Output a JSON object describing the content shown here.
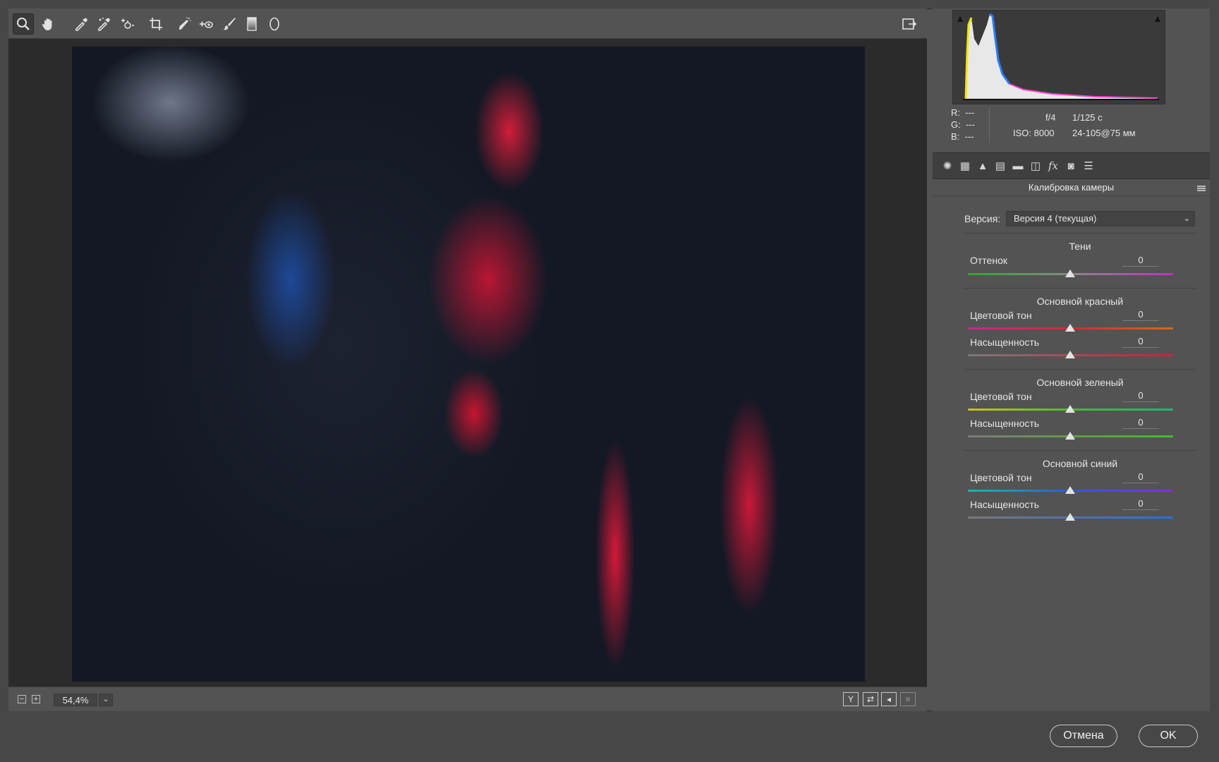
{
  "toolbar": {
    "tools": [
      "zoom-icon",
      "hand-icon",
      "white-balance-eyedropper-icon",
      "color-sampler-icon",
      "targeted-adjustment-icon",
      "crop-icon",
      "spot-removal-icon",
      "red-eye-icon",
      "adjustment-brush-icon",
      "graduated-filter-icon",
      "radial-filter-icon"
    ],
    "fullscreen_icon": "fullscreen-toggle-icon"
  },
  "bottombar": {
    "zoom_minus": "−",
    "zoom_plus": "+",
    "zoom_value": "54,4%",
    "zoom_dropdown": "⌄",
    "view_y_label": "Y",
    "swap_label": "⇄",
    "copy_label": "◂",
    "settings_label": "≡"
  },
  "info": {
    "r_label": "R:",
    "r_value": "---",
    "g_label": "G:",
    "g_value": "---",
    "b_label": "B:",
    "b_value": "---",
    "aperture": "f/4",
    "shutter": "1/125 с",
    "iso": "ISO: 8000",
    "lens": "24-105@75 мм"
  },
  "panel": {
    "title": "Калибровка камеры",
    "version_label": "Версия:",
    "version_value": "Версия 4 (текущая)",
    "version_chevron": "⌄",
    "sections": {
      "shadows": {
        "title": "Тени",
        "tint": {
          "label": "Оттенок",
          "value": "0"
        }
      },
      "red": {
        "title": "Основной красный",
        "hue": {
          "label": "Цветовой тон",
          "value": "0"
        },
        "sat": {
          "label": "Насыщенность",
          "value": "0"
        }
      },
      "green": {
        "title": "Основной зеленый",
        "hue": {
          "label": "Цветовой тон",
          "value": "0"
        },
        "sat": {
          "label": "Насыщенность",
          "value": "0"
        }
      },
      "blue": {
        "title": "Основной синий",
        "hue": {
          "label": "Цветовой тон",
          "value": "0"
        },
        "sat": {
          "label": "Насыщенность",
          "value": "0"
        }
      }
    }
  },
  "dialog": {
    "cancel_label": "Отмена",
    "ok_label": "OK"
  },
  "colors": {
    "panel_bg": "#535353",
    "canvas_bg": "#2b2b2b",
    "thumb": "#e3e3e3"
  }
}
